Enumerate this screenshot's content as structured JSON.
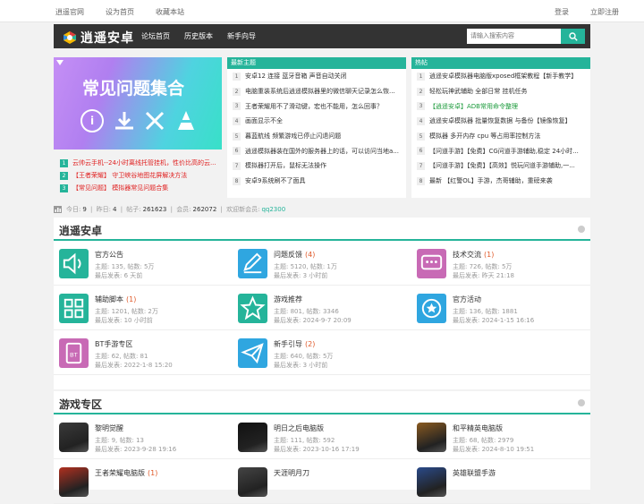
{
  "topbar": {
    "left": [
      "逍遥官网",
      "设为首页",
      "收藏本站"
    ],
    "right": [
      "登录",
      "立即注册"
    ]
  },
  "nav": {
    "logo_text": "逍遥安卓",
    "links": [
      "论坛首页",
      "历史版本",
      "新手向导"
    ],
    "search_placeholder": "请输入搜索内容"
  },
  "banner": {
    "title": "常见问题集合"
  },
  "banner_list": [
    {
      "num": "1",
      "text": "云帅云手机--24小时离线托管挂机，性价比高的云..."
    },
    {
      "num": "2",
      "text": "【王者荣耀】 守卫峡谷地图花屏解决方法"
    },
    {
      "num": "3",
      "text": "【常见问题】 模拟器常见问题合集"
    }
  ],
  "latest": {
    "title": "最新主题",
    "items": [
      {
        "num": "1",
        "text": "安卓12 连接 蓝牙音箱 声音自动关闭"
      },
      {
        "num": "2",
        "text": "电脑重装系统后逍遥模拟器里的微信聊天记录怎么恢..."
      },
      {
        "num": "3",
        "text": "王者荣耀用不了滑动键，宏也不能用，怎么回事？"
      },
      {
        "num": "4",
        "text": "画面显示不全"
      },
      {
        "num": "5",
        "text": "暮蓝航线 频繁游戏已停止闪退问题"
      },
      {
        "num": "6",
        "text": "逍遥模拟器装在国外的服务器上的话，可以访问当地a..."
      },
      {
        "num": "7",
        "text": "模拟器打开后，鼠标无法操作"
      },
      {
        "num": "8",
        "text": "安卓9系统刷不了面具"
      }
    ]
  },
  "hot": {
    "title": "热帖",
    "items": [
      {
        "num": "1",
        "text": "逍遥安卓模拟器电脑版xposed框架教程【新手教学】",
        "color": "#333333"
      },
      {
        "num": "2",
        "text": "轻松玩神武辅助 全部日常 挂机任务",
        "color": "#333333"
      },
      {
        "num": "3",
        "text": "【逍遥安卓】ADB常用命令整理",
        "color": "#1a9a3a"
      },
      {
        "num": "4",
        "text": "逍遥安卓模拟器 批量恢复数据 与备份【镜像恢复】",
        "color": "#333333"
      },
      {
        "num": "5",
        "text": "模拟器 多开内存 cpu 等占用率控制方法",
        "color": "#333333"
      },
      {
        "num": "6",
        "text": "【问道手游】【免费】CG问道手游辅助,稳定 24小时...",
        "color": "#333333"
      },
      {
        "num": "7",
        "text": "【问道手游】【免费】【高效】悦玩问道手游辅助,一...",
        "color": "#333333"
      },
      {
        "num": "8",
        "text": "最新 【红警OL】手游，杰哥辅助，重磅来袭",
        "color": "#333333"
      }
    ]
  },
  "stats": {
    "today_label": "今日:",
    "today": "9",
    "yesterday_label": "昨日:",
    "yesterday": "4",
    "posts_label": "帖子:",
    "posts": "261623",
    "members_label": "会员:",
    "members": "262072",
    "welcome_label": "欢迎新会员:",
    "new_member": "qq2300"
  },
  "forum_section": {
    "title": "逍遥安卓",
    "forums": [
      {
        "name": "官方公告",
        "count": "",
        "s1": "主题: 135, 帖数: 5万",
        "s2": "最后发表: 6 天前",
        "color": "#25b49a",
        "icon": "speaker-icon"
      },
      {
        "name": "问题反馈",
        "count": "(4)",
        "s1": "主题: 5120, 帖数: 1万",
        "s2": "最后发表: 3 小时前",
        "color": "#2fa6e0",
        "icon": "edit-icon"
      },
      {
        "name": "技术交流",
        "count": "(1)",
        "s1": "主题: 726, 帖数: 5万",
        "s2": "最后发表: 昨天 21:18",
        "color": "#c86ab5",
        "icon": "chat-icon"
      },
      {
        "name": "辅助脚本",
        "count": "(1)",
        "s1": "主题: 1201, 帖数: 2万",
        "s2": "最后发表: 10 小时前",
        "color": "#25b49a",
        "icon": "grid-icon"
      },
      {
        "name": "游戏推荐",
        "count": "",
        "s1": "主题: 801, 帖数: 3346",
        "s2": "最后发表: 2024-9-7 20:09",
        "color": "#25b49a",
        "icon": "star-icon"
      },
      {
        "name": "官方活动",
        "count": "",
        "s1": "主题: 136, 帖数: 1881",
        "s2": "最后发表: 2024-1-15 16:16",
        "color": "#2fa6e0",
        "icon": "medal-icon"
      },
      {
        "name": "BT手游专区",
        "count": "",
        "s1": "主题: 62, 帖数: 81",
        "s2": "最后发表: 2022-1-8 15:20",
        "color": "#c86ab5",
        "icon": "bt-icon"
      },
      {
        "name": "新手引导",
        "count": "(2)",
        "s1": "主题: 640, 帖数: 5万",
        "s2": "最后发表: 3 小时前",
        "color": "#2fa6e0",
        "icon": "paper-plane-icon"
      },
      {
        "name": "",
        "count": "",
        "s1": "",
        "s2": "",
        "color": "",
        "icon": ""
      }
    ]
  },
  "game_section": {
    "title": "游戏专区",
    "games": [
      {
        "name": "黎明觉醒",
        "count": "",
        "s1": "主题: 9, 帖数: 13",
        "s2": "最后发表: 2023-9-28 19:16",
        "bg": "#3a3a3a"
      },
      {
        "name": "明日之后电脑版",
        "count": "",
        "s1": "主题: 111, 帖数: 592",
        "s2": "最后发表: 2023-10-16 17:19",
        "bg": "#111111"
      },
      {
        "name": "和平精英电脑版",
        "count": "",
        "s1": "主题: 68, 帖数: 2979",
        "s2": "最后发表: 2024-8-10 19:51",
        "bg": "#8a5a20"
      },
      {
        "name": "王者荣耀电脑版",
        "count": "(1)",
        "s1": "",
        "s2": "",
        "bg": "#b03020"
      },
      {
        "name": "天涯明月刀",
        "count": "",
        "s1": "",
        "s2": "",
        "bg": "#444444"
      },
      {
        "name": "英雄联盟手游",
        "count": "",
        "s1": "",
        "s2": "",
        "bg": "#2a4a8a"
      }
    ]
  }
}
